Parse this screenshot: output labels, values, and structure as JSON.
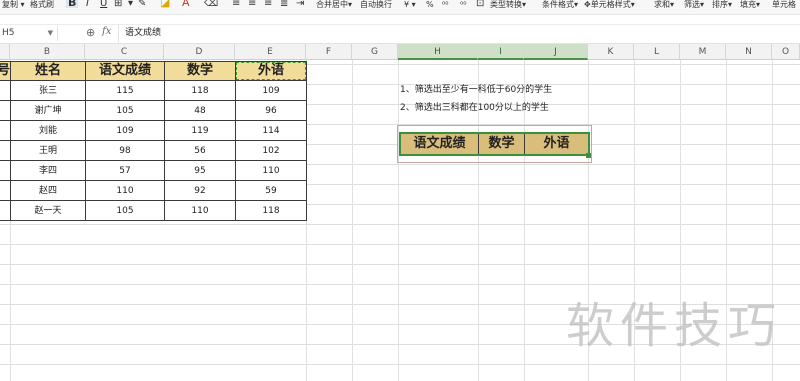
{
  "toolbar": {
    "copy_label": "复制",
    "format_painter_label": "格式刷",
    "bold_label": "B",
    "merge_center_label": "合并居中",
    "wrap_text_label": "自动换行",
    "currency_label": "¥",
    "percent_label": "%",
    "type_convert_label": "类型转换",
    "conditional_format_label": "条件格式",
    "cell_style_label": "单元格样式",
    "sum_label": "求和",
    "filter_label": "筛选",
    "sort_label": "排序",
    "fill_label": "填充",
    "cell_label": "单元格"
  },
  "formula_bar": {
    "name_box": "H5",
    "fx_label": "fx",
    "formula": "语文成绩"
  },
  "columns": [
    "B",
    "C",
    "D",
    "E",
    "F",
    "G",
    "H",
    "I",
    "J",
    "K",
    "L",
    "M",
    "N",
    "O"
  ],
  "table": {
    "headers": [
      "号",
      "姓名",
      "语文成绩",
      "数学",
      "外语"
    ],
    "rows": [
      [
        "张三",
        "115",
        "118",
        "109"
      ],
      [
        "谢广坤",
        "105",
        "48",
        "96"
      ],
      [
        "刘能",
        "109",
        "119",
        "114"
      ],
      [
        "王明",
        "98",
        "56",
        "102"
      ],
      [
        "李四",
        "57",
        "95",
        "110"
      ],
      [
        "赵四",
        "110",
        "92",
        "59"
      ],
      [
        "赵一天",
        "105",
        "110",
        "118"
      ]
    ]
  },
  "notes": {
    "line1": "1、筛选出至少有一科低于60分的学生",
    "line2": "2、筛选出三科都在100分以上的学生"
  },
  "criteria_headers": [
    "语文成绩",
    "数学",
    "外语"
  ],
  "watermark": "软件技巧"
}
